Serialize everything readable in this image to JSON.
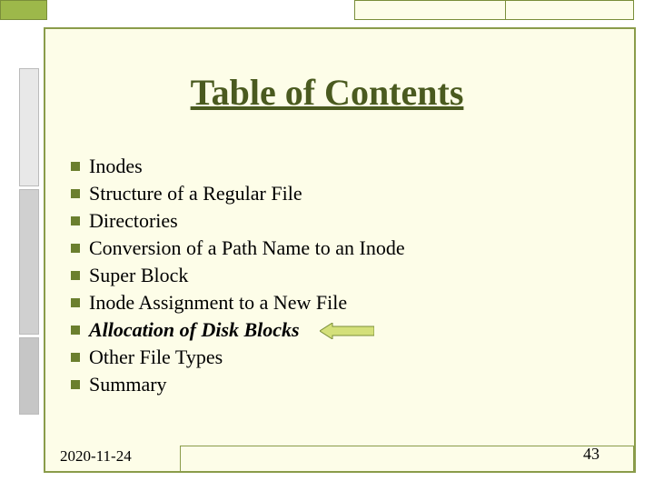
{
  "title": "Table of Contents",
  "toc": {
    "items": [
      {
        "label": "Inodes",
        "emphasis": false
      },
      {
        "label": "Structure of a Regular File",
        "emphasis": false
      },
      {
        "label": "Directories",
        "emphasis": false
      },
      {
        "label": "Conversion of a Path Name to an Inode",
        "emphasis": false
      },
      {
        "label": "Super Block",
        "emphasis": false
      },
      {
        "label": "Inode Assignment to a New File",
        "emphasis": false
      },
      {
        "label": "Allocation of Disk Blocks",
        "emphasis": true
      },
      {
        "label": "Other File Types",
        "emphasis": false
      },
      {
        "label": "Summary",
        "emphasis": false
      }
    ]
  },
  "footer": {
    "date": "2020-11-24",
    "page": "43"
  },
  "colors": {
    "accent": "#9db84a",
    "frame": "#8a9c4a",
    "title": "#4a5a1f",
    "bg": "#fdfde8"
  }
}
